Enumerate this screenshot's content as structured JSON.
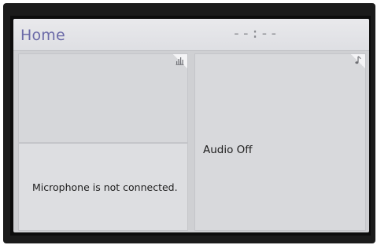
{
  "header": {
    "title": "Home",
    "clock": "--:--"
  },
  "panels": {
    "microphone": {
      "icon": "microphone-level-icon",
      "status": "Microphone is not connected."
    },
    "audio": {
      "icon": "music-note-icon",
      "status": "Audio Off"
    }
  },
  "colors": {
    "title_accent": "#6b6aa8",
    "screen_background": "#cfd0d3"
  }
}
